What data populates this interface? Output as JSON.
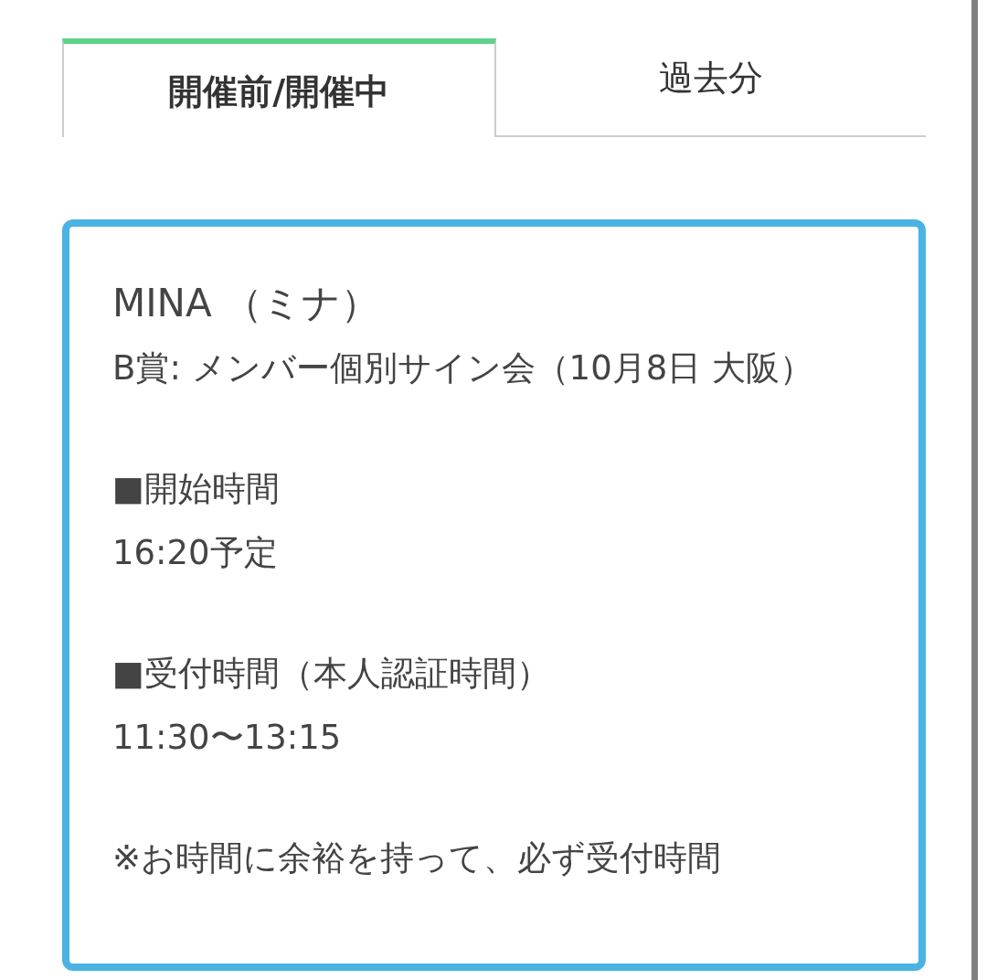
{
  "tabs": [
    {
      "label": "開催前/開催中",
      "selected": true
    },
    {
      "label": "過去分",
      "selected": false
    }
  ],
  "card": {
    "title": "MINA （ミナ）",
    "prize": "B賞: メンバー個別サイン会（10月8日 大阪）",
    "sections": [
      {
        "heading": "■開始時間",
        "value": "16:20予定"
      },
      {
        "heading": "■受付時間（本人認証時間）",
        "value": "11:30〜13:15"
      }
    ],
    "note": "※お時間に余裕を持って、必ず受付時間"
  }
}
